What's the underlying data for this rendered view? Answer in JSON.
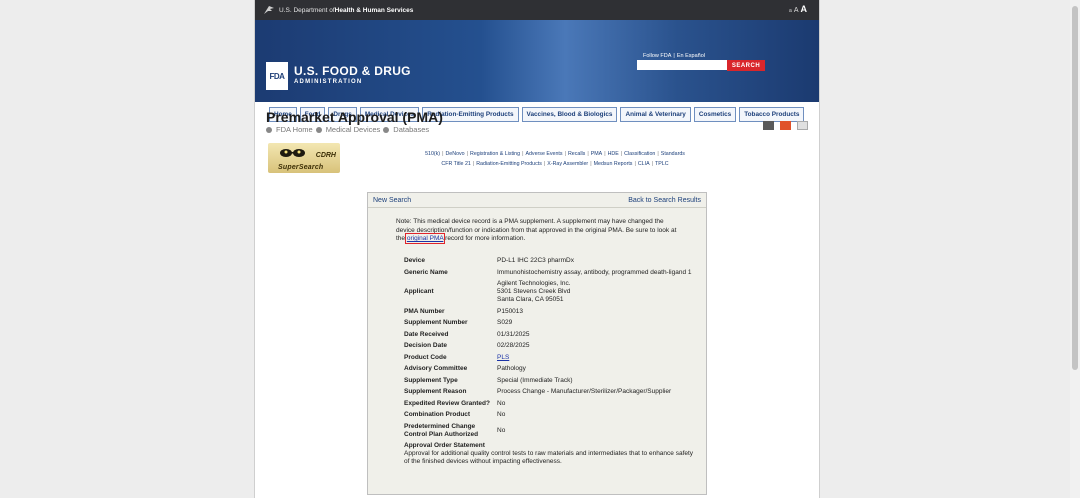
{
  "hhs_bar": {
    "prefix": "U.S. Department of ",
    "bold": "Health & Human Services",
    "text_size": [
      "a",
      "A",
      "A"
    ]
  },
  "header": {
    "logo_text": "FDA",
    "brand_line1": "U.S. FOOD & DRUG",
    "brand_line2": "ADMINISTRATION",
    "follow_link": "Follow FDA",
    "spanish_link": "En Español",
    "search_placeholder": "",
    "search_label": "SEARCH"
  },
  "nav": [
    "Home",
    "Food",
    "Drugs",
    "Medical Devices",
    "Radiation-Emitting Products",
    "Vaccines, Blood & Biologics",
    "Animal & Veterinary",
    "Cosmetics",
    "Tobacco Products"
  ],
  "page": {
    "title": "Premarket Approval (PMA)",
    "breadcrumbs": [
      "FDA Home",
      "Medical Devices",
      "Databases"
    ]
  },
  "logo": {
    "line1": "CDRH",
    "line2": "SuperSearch"
  },
  "superlinks_row1": [
    "510(k)",
    "DeNovo",
    "Registration & Listing",
    "Adverse Events",
    "Recalls",
    "PMA",
    "HDE",
    "Classification",
    "Standards"
  ],
  "superlinks_row2": [
    "CFR Title 21",
    "Radiation-Emitting Products",
    "X-Ray Assembler",
    "Medsun Reports",
    "CLIA",
    "TPLC"
  ],
  "record": {
    "new_search": "New Search",
    "back_link": "Back to Search Results",
    "note_before": "Note: This medical device record is a PMA supplement. A supplement may have changed the device description/function or indication from that approved in the original PMA. Be sure to look at the ",
    "note_link": "original PMA",
    "note_after": " record for more information.",
    "fields": {
      "device": {
        "label": "Device",
        "value": "PD-L1 IHC 22C3 pharmDx"
      },
      "generic_name": {
        "label": "Generic Name",
        "value": "Immunohistochemistry assay, antibody, programmed death-ligand 1"
      },
      "applicant": {
        "label": "Applicant",
        "line1": "Agilent Technologies, Inc.",
        "line2": "5301 Stevens Creek Blvd",
        "line3": "Santa Clara, CA 95051"
      },
      "pma_number": {
        "label": "PMA Number",
        "value": "P150013"
      },
      "supplement_number": {
        "label": "Supplement Number",
        "value": "S029"
      },
      "date_received": {
        "label": "Date Received",
        "value": "01/31/2025"
      },
      "decision_date": {
        "label": "Decision Date",
        "value": "02/28/2025"
      },
      "product_code": {
        "label": "Product Code",
        "value": "PLS"
      },
      "advisory_committee": {
        "label": "Advisory Committee",
        "value": "Pathology"
      },
      "supplement_type": {
        "label": "Supplement Type",
        "value": "Special (Immediate Track)"
      },
      "supplement_reason": {
        "label": "Supplement Reason",
        "value": "Process Change - Manufacturer/Sterilizer/Packager/Supplier"
      },
      "expedited_review": {
        "label": "Expedited Review Granted?",
        "value": "No"
      },
      "combination_product": {
        "label": "Combination Product",
        "value": "No"
      },
      "pccp_label_1": "Predetermined Change",
      "pccp_label_2": "Control Plan Authorized",
      "pccp_value": "No"
    },
    "approval_statement_label": "Approval Order Statement",
    "approval_statement": "Approval for additional quality control tests to raw materials and intermediates that to enhance safety of the finished devices without impacting effectiveness."
  },
  "colors": {
    "banner": "#24508f",
    "search_button": "#d9262b",
    "link": "#1b33a6",
    "highlight": "#e0242b"
  }
}
